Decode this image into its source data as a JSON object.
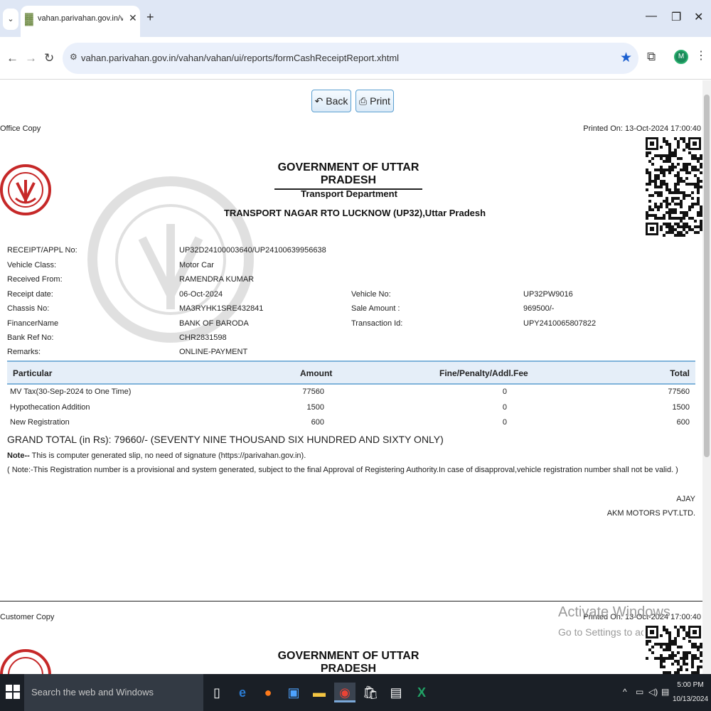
{
  "browser": {
    "tab_title": "vahan.parivahan.gov.in/vahan/v",
    "url": "vahan.parivahan.gov.in/vahan/vahan/ui/reports/formCashReceiptReport.xhtml",
    "profile_initial": "M"
  },
  "toolbar": {
    "back_label": "Back",
    "print_label": "Print"
  },
  "office": {
    "copy_label": "Office Copy",
    "printed_on": "Printed On: 13-Oct-2024 17:00:40",
    "gov_title": "GOVERNMENT OF UTTAR PRADESH",
    "dept": "Transport Department",
    "office_name": "TRANSPORT NAGAR RTO LUCKNOW (UP32),Uttar Pradesh"
  },
  "receipt": {
    "left": [
      {
        "label": "RECEIPT/APPL No:",
        "value": "UP32D24100003640/UP24100639956638"
      },
      {
        "label": "Vehicle Class:",
        "value": "Motor Car"
      },
      {
        "label": "Received From:",
        "value": "RAMENDRA KUMAR"
      },
      {
        "label": "Receipt date:",
        "value": "06-Oct-2024"
      },
      {
        "label": "Chassis No:",
        "value": "MA3RYHK1SRE432841"
      },
      {
        "label": "FinancerName",
        "value": "BANK OF BARODA"
      },
      {
        "label": "Bank Ref No:",
        "value": "CHR2831598"
      },
      {
        "label": "Remarks:",
        "value": "ONLINE-PAYMENT"
      }
    ],
    "right": [
      {
        "label": "Vehicle No:",
        "value": "UP32PW9016"
      },
      {
        "label": "Sale Amount :",
        "value": "969500/-"
      },
      {
        "label": "Transaction Id:",
        "value": "UPY2410065807822"
      }
    ]
  },
  "fees_table": {
    "headers": [
      "Particular",
      "Amount",
      "Fine/Penalty/Addl.Fee",
      "Total"
    ],
    "rows": [
      [
        "MV Tax(30-Sep-2024 to One Time)",
        "77560",
        "0",
        "77560"
      ],
      [
        "Hypothecation Addition",
        "1500",
        "0",
        "1500"
      ],
      [
        "New Registration",
        "600",
        "0",
        "600"
      ]
    ]
  },
  "grand_total": "GRAND TOTAL (in Rs): 79660/- (SEVENTY NINE THOUSAND SIX HUNDRED AND SIXTY ONLY)",
  "notes": {
    "note1_bold": "Note--",
    "note1_text": " This is computer generated slip, no need of signature (https://parivahan.gov.in).",
    "note2": "( Note:-This Registration number is a provisional and system generated, subject to the final Approval of Registering Authority.In case of disapproval,vehicle registration number shall not be valid. )"
  },
  "signatory": {
    "name": "AJAY",
    "dealer": "AKM MOTORS PVT.LTD."
  },
  "customer": {
    "copy_label": "Customer Copy",
    "printed_on": "Printed On: 13-Oct-2024 17:00:40",
    "gov_title": "GOVERNMENT OF UTTAR PRADESH"
  },
  "windows_activation": {
    "title": "Activate Windows",
    "subtitle": "Go to Settings to activate Windows."
  },
  "taskbar": {
    "search_placeholder": "Search the web and Windows",
    "time": "5:00 PM",
    "date": "10/13/2024"
  }
}
